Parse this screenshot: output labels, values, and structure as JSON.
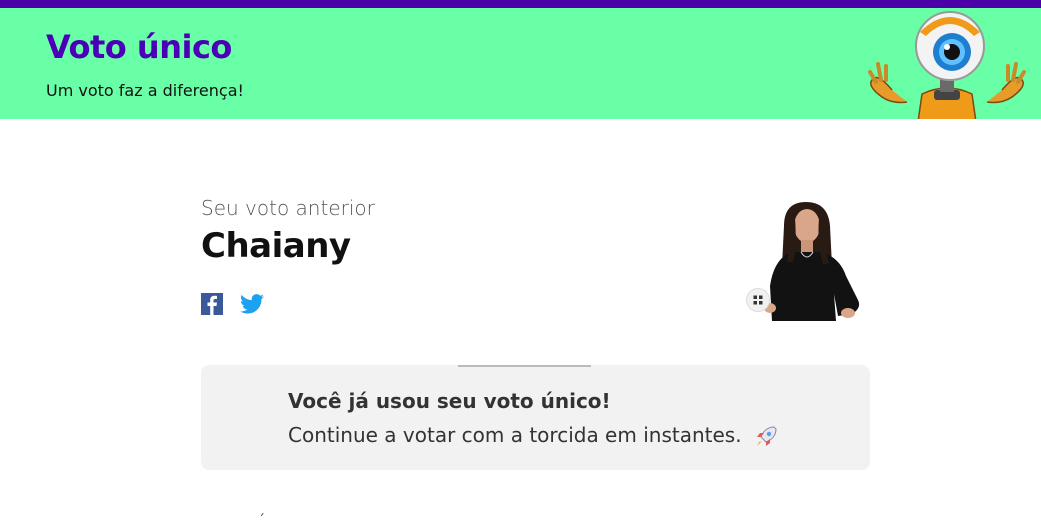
{
  "header": {
    "title": "Voto único",
    "subtitle": "Um voto faz a diferença!",
    "background_color": "#69ffa6",
    "accent_color": "#4b00b8",
    "mascot_icon": "big-brother-eye-robot"
  },
  "previous_vote": {
    "label": "Seu voto anterior",
    "name": "Chaiany"
  },
  "share": {
    "facebook_icon": "facebook-icon",
    "twitter_icon": "twitter-icon"
  },
  "notice": {
    "title": "Você já usou seu voto único!",
    "text": "Continue a votar com a torcida em instantes.",
    "icon": "rocket-icon"
  },
  "footer": {
    "fragment": "´"
  }
}
